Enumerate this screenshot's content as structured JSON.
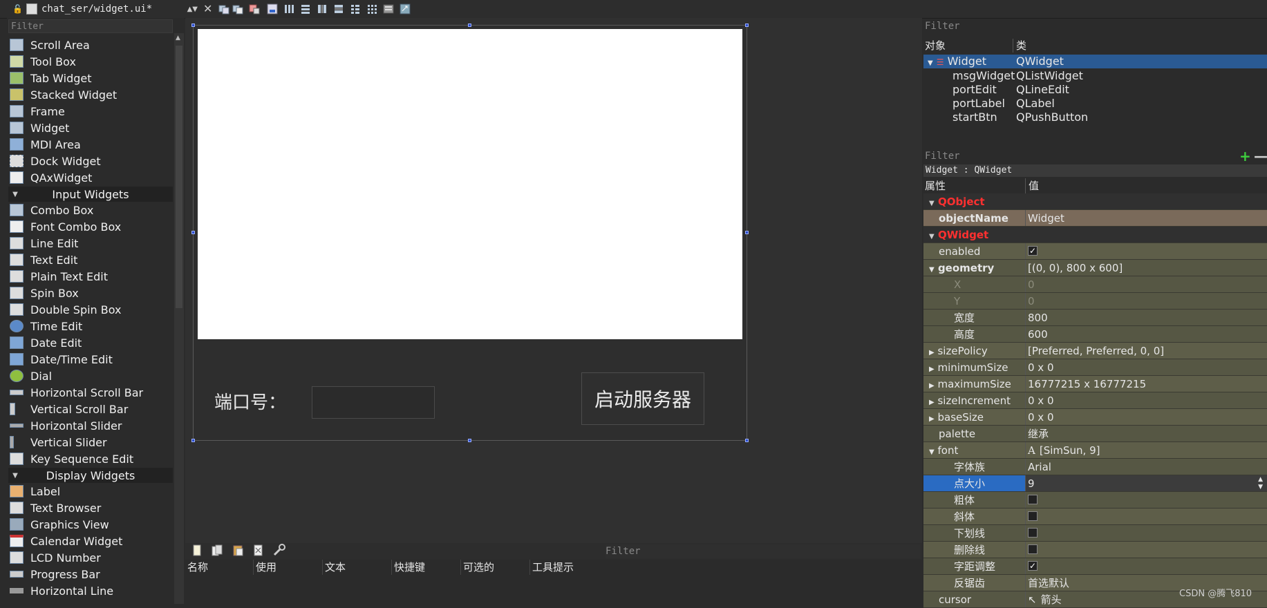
{
  "toolbar": {
    "file_name": "chat_ser/widget.ui*"
  },
  "widget_box": {
    "filter_placeholder": "Filter",
    "items_top": [
      "Scroll Area",
      "Tool Box",
      "Tab Widget",
      "Stacked Widget",
      "Frame",
      "Widget",
      "MDI Area",
      "Dock Widget",
      "QAxWidget"
    ],
    "category_input": "Input Widgets",
    "items_input": [
      "Combo Box",
      "Font Combo Box",
      "Line Edit",
      "Text Edit",
      "Plain Text Edit",
      "Spin Box",
      "Double Spin Box",
      "Time Edit",
      "Date Edit",
      "Date/Time Edit",
      "Dial",
      "Horizontal Scroll Bar",
      "Vertical Scroll Bar",
      "Horizontal Slider",
      "Vertical Slider",
      "Key Sequence Edit"
    ],
    "category_display": "Display Widgets",
    "items_display": [
      "Label",
      "Text Browser",
      "Graphics View",
      "Calendar Widget",
      "LCD Number",
      "Progress Bar",
      "Horizontal Line"
    ]
  },
  "form": {
    "port_label": "端口号：",
    "start_button": "启动服务器"
  },
  "action_editor": {
    "filter_placeholder": "Filter",
    "columns": [
      "名称",
      "使用",
      "文本",
      "快捷键",
      "可选的",
      "工具提示"
    ]
  },
  "object_inspector": {
    "filter_placeholder": "Filter",
    "col_object": "对象",
    "col_class": "类",
    "rows": [
      {
        "name": "Widget",
        "cls": "QWidget"
      },
      {
        "name": "msgWidget",
        "cls": "QListWidget"
      },
      {
        "name": "portEdit",
        "cls": "QLineEdit"
      },
      {
        "name": "portLabel",
        "cls": "QLabel"
      },
      {
        "name": "startBtn",
        "cls": "QPushButton"
      }
    ]
  },
  "property_editor": {
    "filter_placeholder": "Filter",
    "class_line": "Widget : QWidget",
    "col_property": "属性",
    "col_value": "值",
    "group_qobject": "QObject",
    "group_qwidget": "QWidget",
    "rows": {
      "objectName": [
        "objectName",
        "Widget"
      ],
      "enabled": [
        "enabled",
        ""
      ],
      "geometry": [
        "geometry",
        "[(0, 0), 800 x 600]"
      ],
      "x": [
        "X",
        "0"
      ],
      "y": [
        "Y",
        "0"
      ],
      "width": [
        "宽度",
        "800"
      ],
      "height": [
        "高度",
        "600"
      ],
      "sizePolicy": [
        "sizePolicy",
        "[Preferred, Preferred, 0, 0]"
      ],
      "minimumSize": [
        "minimumSize",
        "0 x 0"
      ],
      "maximumSize": [
        "maximumSize",
        "16777215 x 16777215"
      ],
      "sizeIncrement": [
        "sizeIncrement",
        "0 x 0"
      ],
      "baseSize": [
        "baseSize",
        "0 x 0"
      ],
      "palette": [
        "palette",
        "继承"
      ],
      "font": [
        "font",
        "[SimSun, 9]"
      ],
      "family": [
        "字体族",
        "Arial"
      ],
      "pointSize": [
        "点大小",
        "9"
      ],
      "bold": [
        "粗体",
        ""
      ],
      "italic": [
        "斜体",
        ""
      ],
      "underline": [
        "下划线",
        ""
      ],
      "strikeout": [
        "删除线",
        ""
      ],
      "kerning": [
        "字距调整",
        ""
      ],
      "antialias": [
        "反锯齿",
        "首选默认"
      ],
      "cursor": [
        "cursor",
        "箭头"
      ]
    }
  },
  "watermark": "CSDN @腾飞810"
}
